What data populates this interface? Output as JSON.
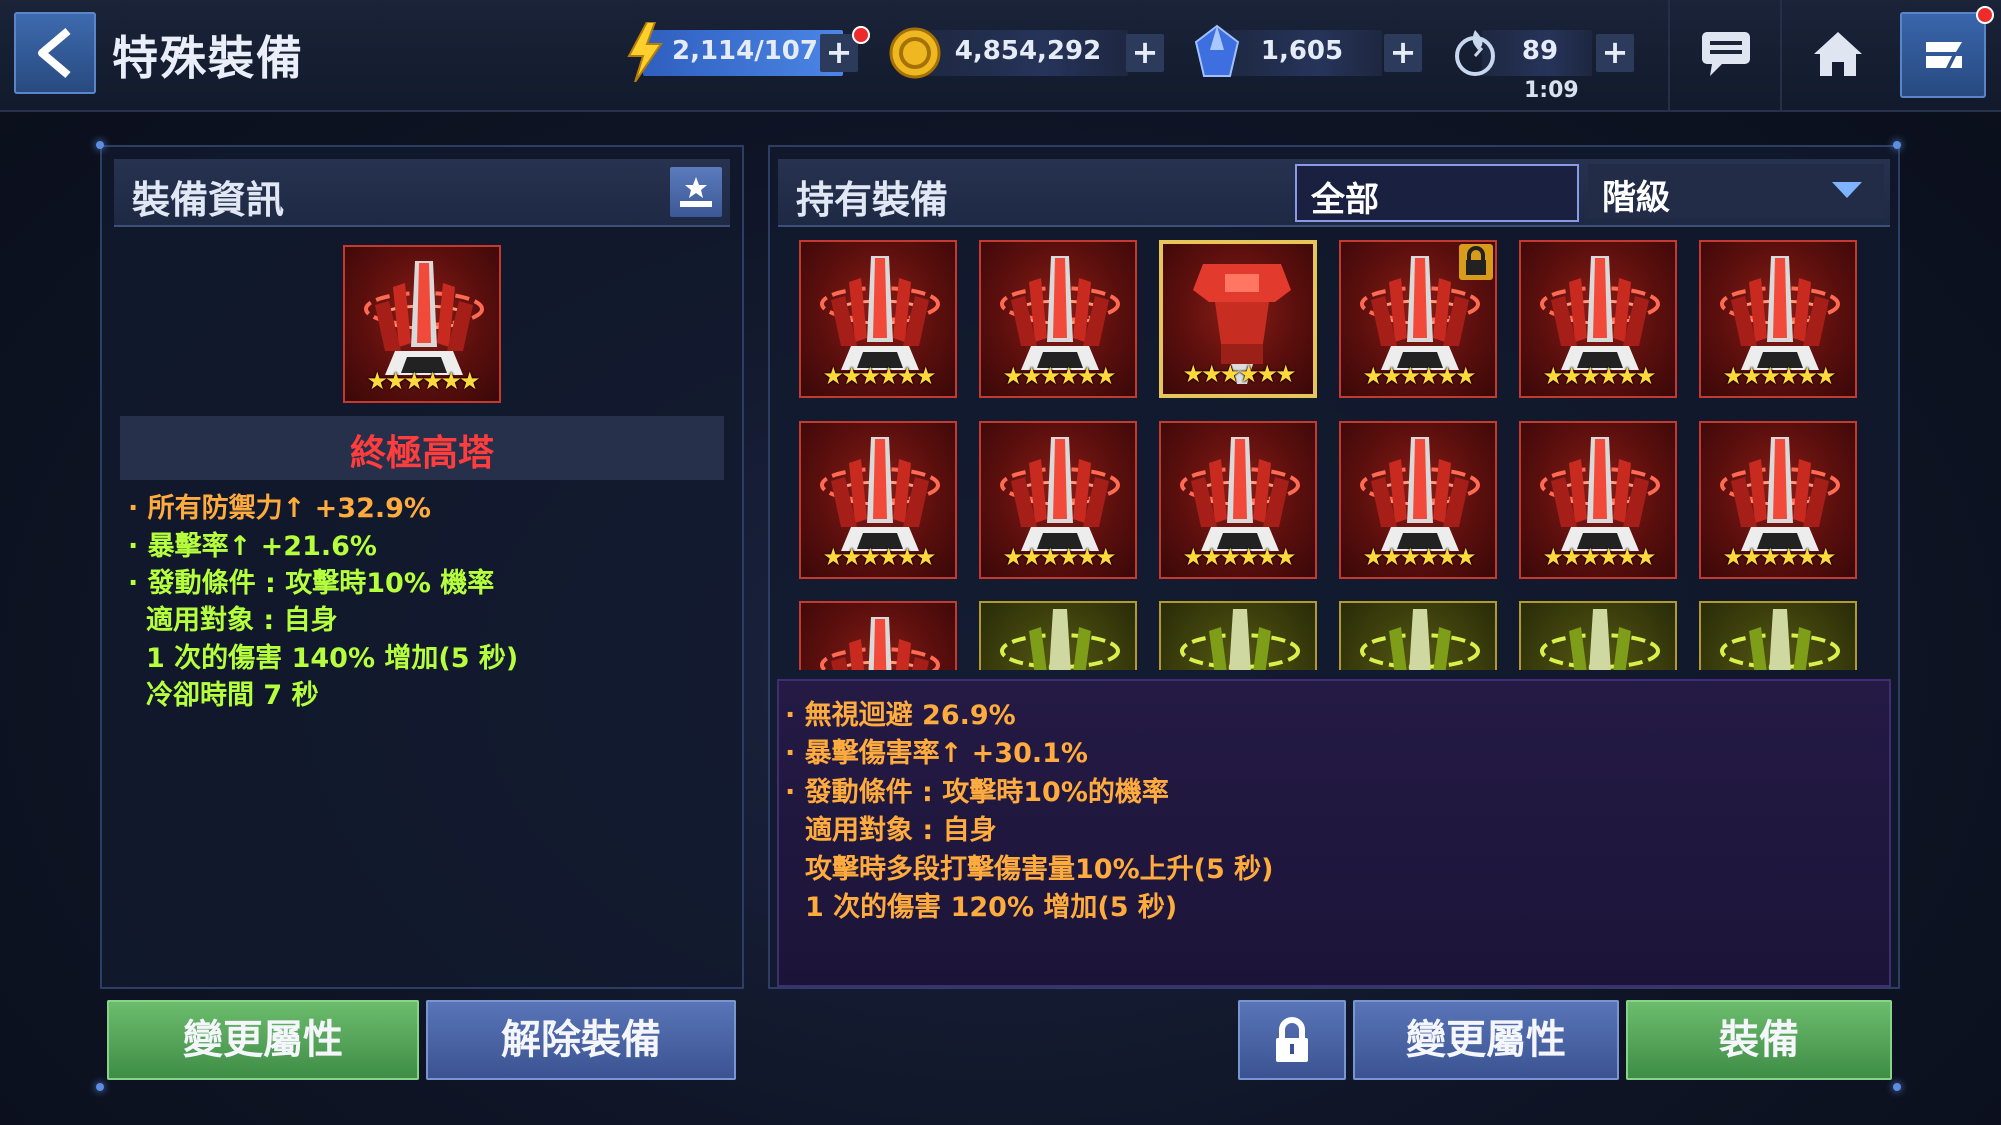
{
  "header": {
    "title": "特殊裝備",
    "energy": "2,114/107",
    "gold": "4,854,292",
    "crystals": "1,605",
    "stamina": "89",
    "stamina_timer": "1:09"
  },
  "left_panel": {
    "title": "裝備資訊",
    "item_name": "終極高塔",
    "item_stars": "★★★★★★",
    "stats": [
      "· 所有防禦力↑ +32.9%",
      "· 暴擊率↑ +21.6%",
      "· 發動條件 : 攻擊時10% 機率",
      "適用對象 : 自身",
      "1 次的傷害 140% 增加(5 秒)",
      "冷卻時間 7 秒"
    ]
  },
  "right_panel": {
    "title": "持有裝備",
    "filter": "全部",
    "sort": "階級",
    "tile_stars": "★★★★★★",
    "detail": [
      "· 無視迴避 26.9%",
      "· 暴擊傷害率↑ +30.1%",
      "· 發動條件 : 攻擊時10%的機率",
      "適用對象 : 自身",
      "攻擊時多段打擊傷害量10%上升(5 秒)",
      "1 次的傷害 120% 增加(5 秒)"
    ]
  },
  "buttons": {
    "left_change": "變更屬性",
    "unequip": "解除裝備",
    "right_change": "變更屬性",
    "equip": "裝備"
  },
  "colors": {
    "accent_red": "#ff3d3d",
    "stat_orange": "#ffab3d",
    "stat_green": "#b6ff3d",
    "button_green": "#4f9f55",
    "button_blue": "#4661a3"
  }
}
